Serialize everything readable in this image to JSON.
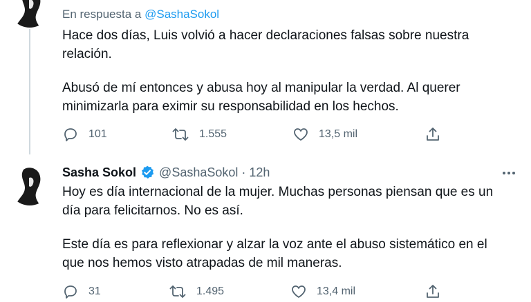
{
  "tweet1": {
    "reply_prefix": "En respuesta a",
    "reply_mention": "@SashaSokol",
    "paragraph1": "Hace dos días, Luis volvió a hacer declaraciones falsas sobre nuestra\nrelación.",
    "paragraph2": "Abusó de mí entonces y abusa hoy al manipular la verdad. Al querer\nminimizarla para eximir su responsabilidad en los hechos.",
    "actions": {
      "replies": "101",
      "retweets": "1.555",
      "likes": "13,5 mil"
    }
  },
  "tweet2": {
    "author_name": "Sasha Sokol",
    "handle": "@SashaSokol",
    "separator": "·",
    "time": "12h",
    "paragraph1": "Hoy es día internacional de la mujer. Muchas personas piensan que es un\ndía para felicitarnos. No es así.",
    "paragraph2": "Este día es para reflexionar y alzar la voz ante el abuso sistemático en el\nque nos hemos visto atrapadas de mil maneras.",
    "actions": {
      "replies": "31",
      "retweets": "1.495",
      "likes": "13,4 mil"
    }
  },
  "colors": {
    "text": "#0f1419",
    "secondary": "#536471",
    "accent": "#1d9bf0",
    "thread_line": "#cfd9de"
  },
  "icons": [
    "reply-icon",
    "retweet-icon",
    "like-icon",
    "share-icon",
    "verified-badge-icon",
    "more-options-icon"
  ]
}
